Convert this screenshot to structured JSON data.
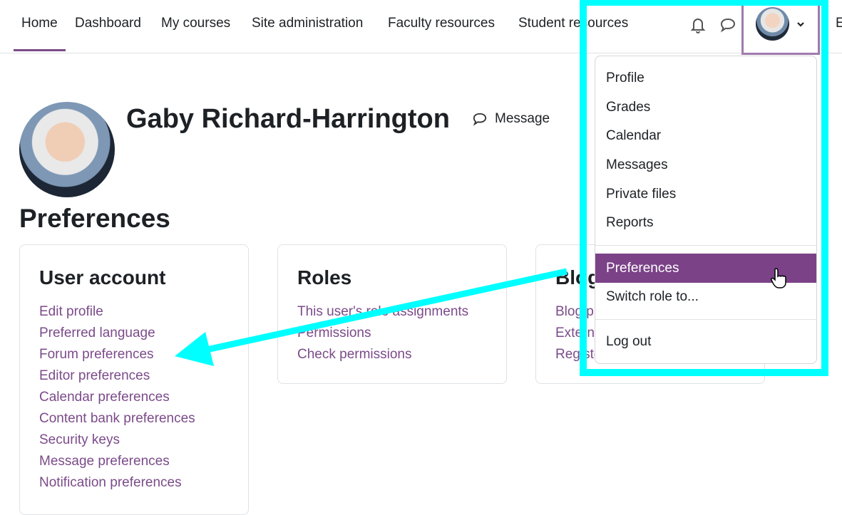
{
  "nav": {
    "items": [
      "Home",
      "Dashboard",
      "My courses",
      "Site administration",
      "Faculty resources",
      "Student resources"
    ],
    "active": "Home",
    "overflow_text": "E"
  },
  "profile": {
    "name": "Gaby Richard-Harrington",
    "message_label": "Message"
  },
  "page_title": "Preferences",
  "cards": [
    {
      "title": "User account",
      "links": [
        "Edit profile",
        "Preferred language",
        "Forum preferences",
        "Editor preferences",
        "Calendar preferences",
        "Content bank preferences",
        "Security keys",
        "Message preferences",
        "Notification preferences"
      ]
    },
    {
      "title": "Roles",
      "links": [
        "This user's role assignments",
        "Permissions",
        "Check permissions"
      ]
    },
    {
      "title": "Blogs",
      "links": [
        "Blog preferences",
        "External blogs",
        "Register an external blog"
      ]
    }
  ],
  "user_menu": {
    "items": [
      "Profile",
      "Grades",
      "Calendar",
      "Messages",
      "Private files",
      "Reports",
      "Preferences",
      "Switch role to...",
      "Log out"
    ],
    "active": "Preferences"
  },
  "colors": {
    "brand": "#7b4288",
    "link": "#7b4b8a",
    "annotation": "#00ffff"
  }
}
